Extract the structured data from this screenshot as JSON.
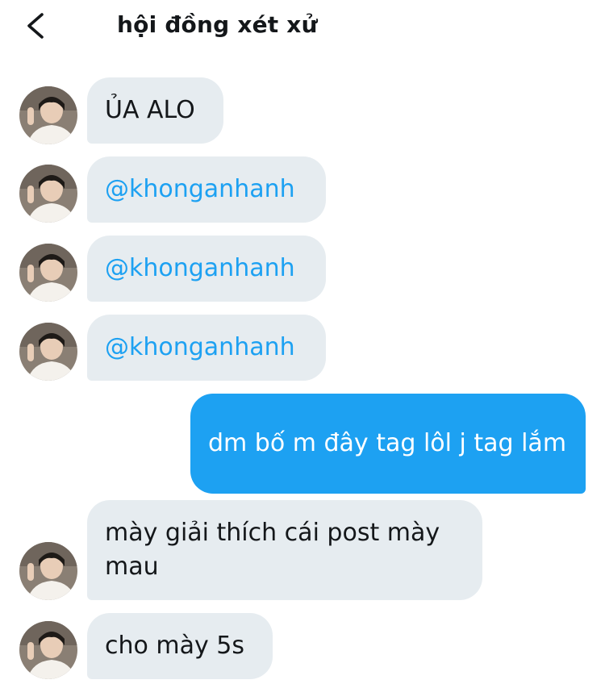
{
  "header": {
    "title": "hội đồng xét xử",
    "back_icon": "chevron-left-icon"
  },
  "colors": {
    "incoming_bubble": "#e6ecf0",
    "outgoing_bubble": "#1da1f2",
    "mention_text": "#1da1f2",
    "text": "#14171a"
  },
  "messages": [
    {
      "direction": "incoming",
      "text": "ỦA ALO"
    },
    {
      "direction": "incoming",
      "text": "@khonganhanh",
      "mention": true
    },
    {
      "direction": "incoming",
      "text": "@khonganhanh",
      "mention": true
    },
    {
      "direction": "incoming",
      "text": "@khonganhanh",
      "mention": true
    },
    {
      "direction": "outgoing",
      "text": "dm bố m đây tag lôl j tag lắm"
    },
    {
      "direction": "incoming",
      "text": "mày giải thích cái post mày mau"
    },
    {
      "direction": "incoming",
      "text": "cho mày 5s"
    }
  ]
}
